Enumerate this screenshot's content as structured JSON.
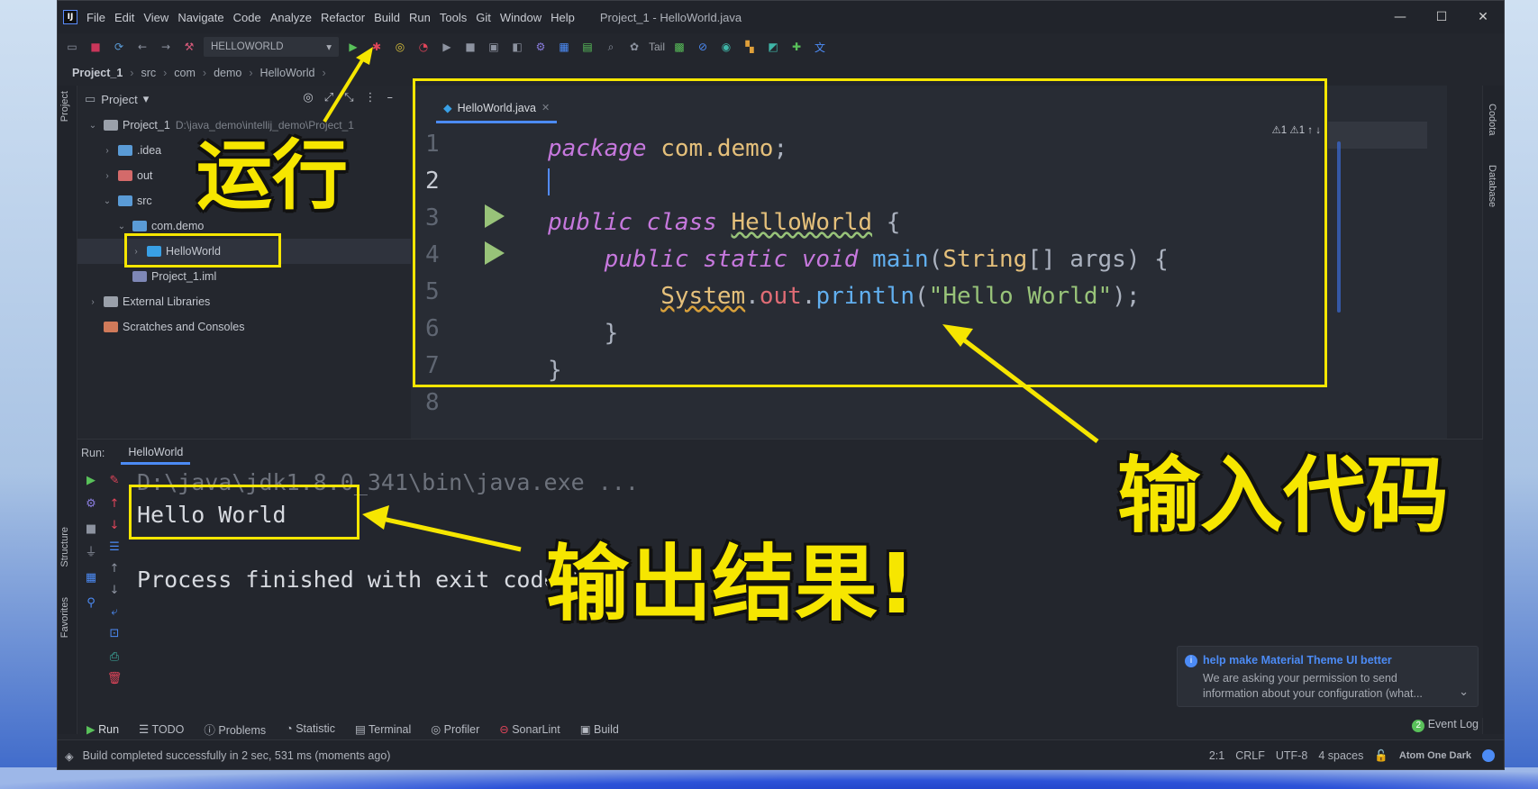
{
  "window": {
    "title": "Project_1 - HelloWorld.java",
    "menu": [
      "File",
      "Edit",
      "View",
      "Navigate",
      "Code",
      "Analyze",
      "Refactor",
      "Build",
      "Run",
      "Tools",
      "Git",
      "Window",
      "Help"
    ],
    "controls": [
      "—",
      "☐",
      "✕"
    ]
  },
  "toolbar": {
    "run_config": "HELLOWORLD",
    "tail_label": "Tail"
  },
  "breadcrumb": [
    "Project_1",
    "src",
    "com",
    "demo",
    "HelloWorld"
  ],
  "project_panel": {
    "title": "Project",
    "tree": [
      {
        "label": "Project_1",
        "sub": "D:\\java_demo\\intellij_demo\\Project_1",
        "depth": 0,
        "arrow": "⌄",
        "color": "#9aa0aa"
      },
      {
        "label": ".idea",
        "depth": 1,
        "arrow": "›",
        "color": "#5a9bd6"
      },
      {
        "label": "out",
        "depth": 1,
        "arrow": "›",
        "color": "#d46a6a"
      },
      {
        "label": "src",
        "depth": 1,
        "arrow": "⌄",
        "color": "#5a9bd6"
      },
      {
        "label": "com.demo",
        "depth": 2,
        "arrow": "⌄",
        "color": "#5a9bd6"
      },
      {
        "label": "HelloWorld",
        "depth": 3,
        "arrow": "›",
        "color": "#39a0e6"
      },
      {
        "label": "Project_1.iml",
        "depth": 2,
        "arrow": "",
        "color": "#7e87b6"
      },
      {
        "label": "External Libraries",
        "depth": 0,
        "arrow": "›",
        "color": "#9aa0aa"
      },
      {
        "label": "Scratches and Consoles",
        "depth": 0,
        "arrow": "",
        "color": "#d07a5a"
      }
    ]
  },
  "editor": {
    "tab": "HelloWorld.java",
    "line_numbers": [
      "1",
      "2",
      "3",
      "4",
      "5",
      "6",
      "7",
      "8"
    ],
    "inspections": "⚠1  ⚠1  ↑  ↓"
  },
  "run_panel": {
    "label": "Run:",
    "tab": "HelloWorld",
    "console": [
      "D:\\java\\jdk1.8.0_341\\bin\\java.exe ...",
      "Hello World",
      "",
      "Process finished with exit code 0"
    ]
  },
  "notification": {
    "title": "help make Material Theme UI better",
    "body_line1": "We are asking your permission to send",
    "body_line2": "information about your configuration (what..."
  },
  "bottom_tabs": [
    "Run",
    "TODO",
    "Problems",
    "Statistic",
    "Terminal",
    "Profiler",
    "SonarLint",
    "Build"
  ],
  "event_log": "Event Log",
  "event_log_count": "2",
  "statusbar": {
    "message": "Build completed successfully in 2 sec, 531 ms (moments ago)",
    "position": "2:1",
    "line_sep": "CRLF",
    "encoding": "UTF-8",
    "indent": "4 spaces",
    "theme": "Atom One Dark"
  },
  "side_tabs": {
    "left_top": "Project",
    "left_mid": "Structure",
    "left_bottom": "Favorites",
    "right_top": "Codota",
    "right_mid": "Database"
  },
  "annotations": {
    "run": "运行",
    "input_code": "输入代码",
    "output": "输出结果!"
  },
  "colors": {
    "highlight": "#f6e600",
    "accent": "#4c8bf5",
    "run_green": "#98c379"
  }
}
